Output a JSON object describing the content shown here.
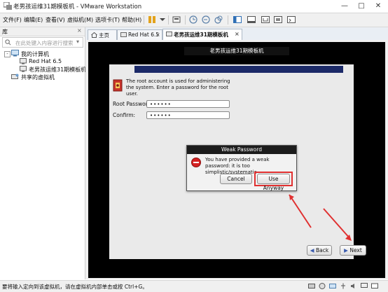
{
  "window": {
    "title": "老男孩运维31期模板机 - VMware Workstation"
  },
  "menu": {
    "items": [
      "文件(F)",
      "编辑(E)",
      "查看(V)",
      "虚拟机(M)",
      "选项卡(T)",
      "帮助(H)"
    ]
  },
  "library": {
    "title": "库",
    "search_placeholder": "在此处键入内容进行搜索",
    "tree": {
      "root": "我的计算机",
      "vm1": "Red Hat 6.5",
      "vm2": "老男孩运维31期模板机",
      "shared": "共享的虚拟机"
    }
  },
  "tabs": {
    "home": "主页",
    "redhat": "Red Hat 6.5",
    "active": "老男孩运维31期模板机"
  },
  "vm": {
    "label": "老男孩运维31期模板机",
    "installer": {
      "root_info": "The root account is used for administering the system.  Enter a password for the root user.",
      "root_password_label": "Root Password:",
      "confirm_label": "Confirm:",
      "password_value": "••••••",
      "confirm_value": "••••••",
      "back_label": "Back",
      "next_label": "Next"
    },
    "dialog": {
      "title": "Weak Password",
      "message": "You have provided a weak password: it is too simplistic/systematic",
      "cancel_label": "Cancel",
      "use_anyway_label": "Use Anyway"
    }
  },
  "status": {
    "text": "要将输入定向到该虚拟机，请在虚拟机内部单击或按 Ctrl+G。"
  },
  "colors": {
    "accent": "#1c2a68",
    "highlight": "#e03030"
  }
}
